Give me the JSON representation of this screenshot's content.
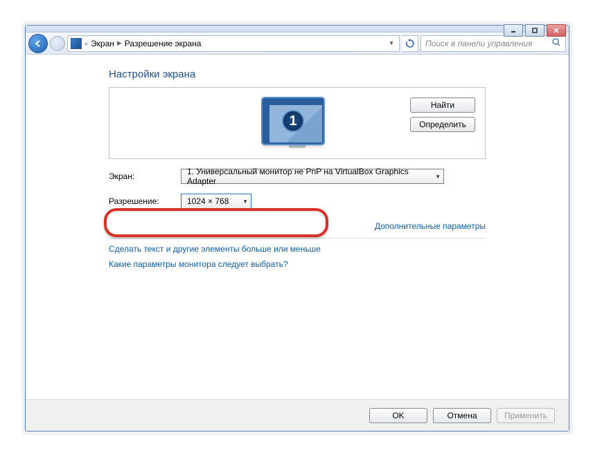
{
  "breadcrumb": {
    "prefix": "«",
    "item1": "Экран",
    "item2": "Разрешение экрана"
  },
  "search": {
    "placeholder": "Поиск в панели управления"
  },
  "page_title": "Настройки экрана",
  "monitor": {
    "number": "1",
    "find_button": "Найти",
    "identify_button": "Определить"
  },
  "form": {
    "display_label": "Экран:",
    "display_value": "1. Универсальный монитор не PnP на VirtualBox Graphics Adapter",
    "resolution_label": "Разрешение:",
    "resolution_value": "1024 × 768"
  },
  "links": {
    "advanced": "Дополнительные параметры",
    "text_size": "Сделать текст и другие элементы больше или меньше",
    "which_monitor": "Какие параметры монитора следует выбрать?"
  },
  "buttons": {
    "ok": "OK",
    "cancel": "Отмена",
    "apply": "Применить"
  }
}
